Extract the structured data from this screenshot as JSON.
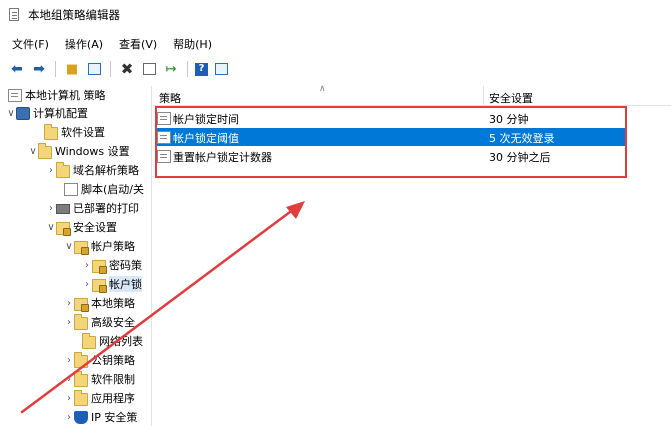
{
  "window": {
    "title": "本地组策略编辑器"
  },
  "menu": [
    "文件(F)",
    "操作(A)",
    "查看(V)",
    "帮助(H)"
  ],
  "toolbar": {
    "icons": [
      "back-arrow-icon",
      "forward-arrow-icon",
      "up-folder-icon",
      "show-tree-icon",
      "delete-icon",
      "properties-icon",
      "export-icon",
      "help-icon",
      "view-icon"
    ]
  },
  "tree": {
    "root": "本地计算机 策略",
    "computer_config": "计算机配置",
    "software_settings": "软件设置",
    "windows_settings": "Windows 设置",
    "dns_policy": "域名解析策略",
    "scripts": "脚本(启动/关",
    "printers": "已部署的打印",
    "security_settings": "安全设置",
    "account_policies": "帐户策略",
    "password_policy": "密码策",
    "account_lockout": "帐户锁",
    "local_policies": "本地策略",
    "advanced_security": "高级安全",
    "network_list": "网络列表",
    "public_key": "公钥策略",
    "software_restriction": "软件限制",
    "app_control": "应用程序",
    "ip_security": "IP 安全策"
  },
  "list": {
    "header": {
      "policy": "策略",
      "setting": "安全设置"
    },
    "rows": [
      {
        "policy": "帐户锁定时间",
        "setting": "30 分钟"
      },
      {
        "policy": "帐户锁定阈值",
        "setting": "5 次无效登录"
      },
      {
        "policy": "重置帐户锁定计数器",
        "setting": "30 分钟之后"
      }
    ]
  },
  "colors": {
    "selection": "#0078d7",
    "highlight_box": "#e23c3c",
    "arrow": "#e23c3c"
  }
}
